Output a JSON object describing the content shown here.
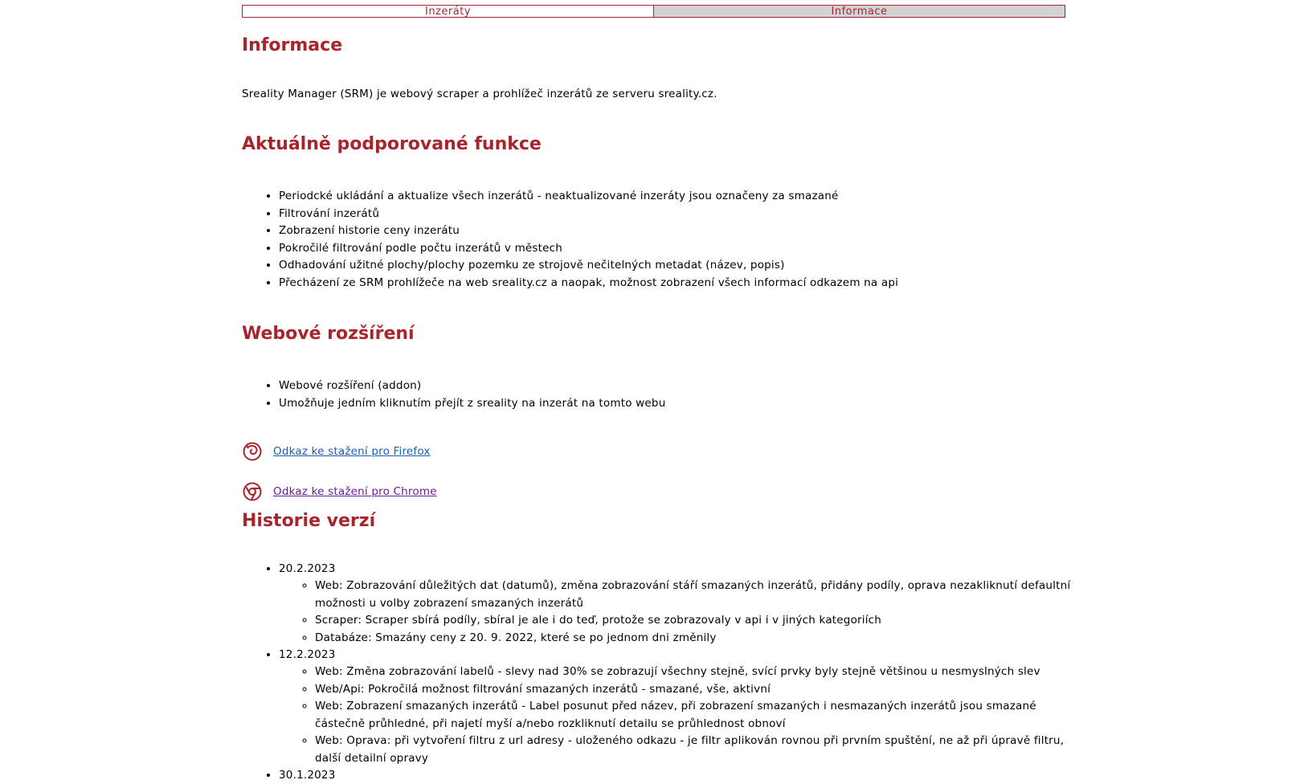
{
  "tabs": [
    {
      "label": "Inzeráty",
      "active": false
    },
    {
      "label": "Informace",
      "active": true
    }
  ],
  "page_title": "Informace",
  "intro": "Sreality Manager (SRM) je webový scraper a prohlížeč inzerátů ze serveru sreality.cz.",
  "features": {
    "heading": "Aktuálně podporované funkce",
    "items": [
      "Periodcké ukládání a aktualize všech inzerátů - neaktualizované inzeráty jsou označeny za smazané",
      "Filtrování inzerátů",
      "Zobrazení historie ceny inzerátu",
      "Pokročilé filtrování podle počtu inzerátů v městech",
      "Odhadování užitné plochy/plochy pozemku ze strojově nečitelných metadat (název, popis)",
      "Přecházení ze SRM prohlížeče na web sreality.cz a naopak, možnost zobrazení všech informací odkazem na api"
    ]
  },
  "extension": {
    "heading": "Webové rozšíření",
    "items": [
      "Webové rozšíření (addon)",
      "Umožňuje jedním kliknutím přejít z sreality na inzerát na tomto webu"
    ],
    "firefox_link": "Odkaz ke stažení pro Firefox",
    "chrome_link": "Odkaz ke stažení pro Chrome"
  },
  "history": {
    "heading": "Historie verzí",
    "versions": [
      {
        "date": "20.2.2023",
        "changes": [
          "Web: Zobrazování důležitých dat (datumů), změna zobrazování stáří smazaných inzerátů, přidány podíly, oprava nezakliknutí defaultní možnosti u volby zobrazení smazaných inzerátů",
          "Scraper: Scraper sbírá podíly, sbíral je ale i do teď, protože se zobrazovaly v api i v jiných kategoriích",
          "Databáze: Smazány ceny z 20. 9. 2022, které se po jednom dni změnily"
        ]
      },
      {
        "date": "12.2.2023",
        "changes": [
          "Web: Změna zobrazování labelů - slevy nad 30% se zobrazují všechny stejně, svící prvky byly stejně většinou u nesmyslných slev",
          "Web/Api: Pokročilá možnost filtrování smazaných inzerátů - smazané, vše, aktivní",
          "Web: Zobrazení smazaných inzerátů - Label posunut před název, při zobrazení smazaných i nesmazaných inzerátů jsou smazané částečně průhledné, při najetí myší a/nebo rozkliknutí detailu se průhlednost obnoví",
          "Web: Oprava: při vytvoření filtru z url adresy - uloženého odkazu - je filtr aplikován rovnou při prvním spuštění, ne až při úpravě filtru, další detailní opravy"
        ]
      },
      {
        "date": "30.1.2023",
        "changes": []
      }
    ]
  },
  "colors": {
    "accent": "#a8252d",
    "active_tab_bg": "#d3d3d3",
    "link_firefox": "#1c5bb0",
    "link_chrome": "#6a1b9a"
  }
}
